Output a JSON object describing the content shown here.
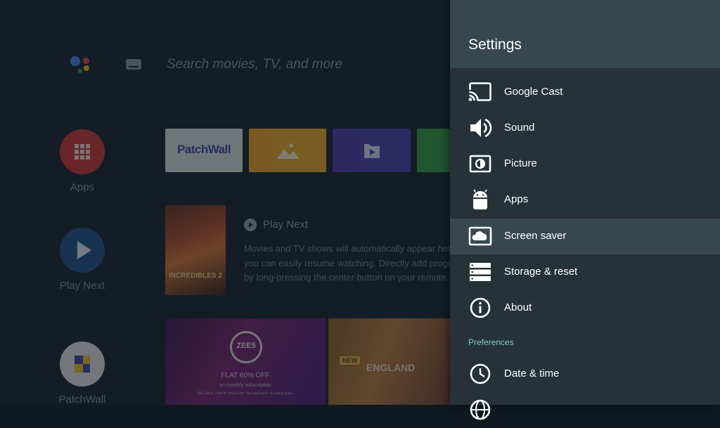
{
  "launcher": {
    "search_placeholder": "Search movies, TV, and more",
    "side_items": [
      {
        "label": "Apps"
      },
      {
        "label": "Play Next"
      },
      {
        "label": "PatchWall"
      }
    ],
    "tiles": [
      {
        "name": "patchwall",
        "text": "PatchWall",
        "color": "#e0e0e0"
      },
      {
        "name": "gallery",
        "color": "#f4a91f"
      },
      {
        "name": "video",
        "color": "#4b3aa8"
      },
      {
        "name": "green",
        "color": "#2f9e3f"
      }
    ],
    "play_next": {
      "title": "Play Next",
      "description_lines": [
        "Movies and TV shows will automatically appear here so",
        "you can easily resume watching. Directly add programs",
        "by long-pressing the center button on your remote."
      ],
      "poster_title": "INCREDIBLES 2"
    },
    "banner_zee": {
      "logo": "ZEE5",
      "offer": "FLAT 60% OFF",
      "sub": "on monthly subscription",
      "fine": "T&C apply. Valid till stocks last. Not applicable on yearly plans."
    },
    "banner_eng": {
      "tag": "NEW",
      "title": "ENGLAND"
    }
  },
  "settings": {
    "title": "Settings",
    "items": [
      {
        "label": "Google Cast",
        "icon": "cast-icon"
      },
      {
        "label": "Sound",
        "icon": "volume-icon"
      },
      {
        "label": "Picture",
        "icon": "picture-icon"
      },
      {
        "label": "Apps",
        "icon": "android-icon"
      },
      {
        "label": "Screen saver",
        "icon": "screen-saver-icon",
        "selected": true
      },
      {
        "label": "Storage & reset",
        "icon": "storage-icon"
      },
      {
        "label": "About",
        "icon": "info-icon"
      }
    ],
    "section": "Preferences",
    "pref_items": [
      {
        "label": "Date & time",
        "icon": "clock-icon"
      },
      {
        "label": "",
        "icon": "globe-icon"
      }
    ],
    "accent_color": "#80cbc4",
    "selected_bg": "#37474f"
  }
}
